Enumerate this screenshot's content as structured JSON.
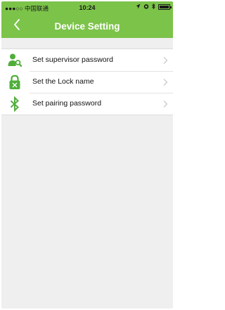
{
  "status_bar": {
    "carrier": "●●●○○ 中国联通",
    "time": "10:24",
    "indicators": [
      "location-icon",
      "alarm-icon",
      "bluetooth-icon",
      "battery-icon"
    ]
  },
  "nav": {
    "back_icon": "chevron-left-icon",
    "title": "Device Setting"
  },
  "colors": {
    "header": "#7cc34a",
    "icon_green": "#4fae3a",
    "background": "#efefef"
  },
  "menu": {
    "items": [
      {
        "icon": "user-key-icon",
        "label": "Set supervisor password"
      },
      {
        "icon": "lock-icon",
        "label": "Set the Lock name"
      },
      {
        "icon": "bluetooth-icon",
        "label": "Set pairing password"
      }
    ]
  }
}
